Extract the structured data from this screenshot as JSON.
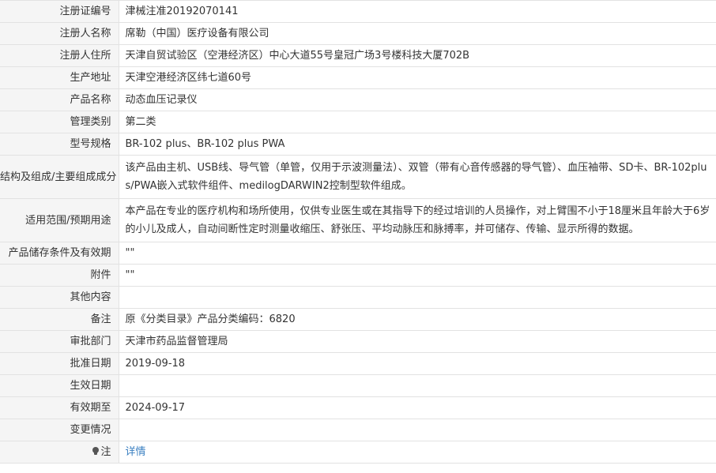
{
  "rows": [
    {
      "label": "注册证编号",
      "value": "津械注准20192070141"
    },
    {
      "label": "注册人名称",
      "value": "席勒（中国）医疗设备有限公司"
    },
    {
      "label": "注册人住所",
      "value": "天津自贸试验区（空港经济区）中心大道55号皇冠广场3号楼科技大厦702B"
    },
    {
      "label": "生产地址",
      "value": "天津空港经济区纬七道60号"
    },
    {
      "label": "产品名称",
      "value": "动态血压记录仪"
    },
    {
      "label": "管理类别",
      "value": "第二类"
    },
    {
      "label": "型号规格",
      "value": "BR-102 plus、BR-102 plus PWA"
    },
    {
      "label": "结构及组成/主要组成成分",
      "value": "该产品由主机、USB线、导气管（单管，仅用于示波测量法）、双管（带有心音传感器的导气管）、血压袖带、SD卡、BR-102plus/PWA嵌入式软件组件、medilogDARWIN2控制型软件组成。"
    },
    {
      "label": "适用范围/预期用途",
      "value": "本产品在专业的医疗机构和场所使用，仅供专业医生或在其指导下的经过培训的人员操作，对上臂围不小于18厘米且年龄大于6岁的小儿及成人，自动间断性定时测量收缩压、舒张压、平均动脉压和脉搏率，并可储存、传输、显示所得的数据。"
    },
    {
      "label": "产品储存条件及有效期",
      "value": "\"\""
    },
    {
      "label": "附件",
      "value": "\"\""
    },
    {
      "label": "其他内容",
      "value": ""
    },
    {
      "label": "备注",
      "value": "原《分类目录》产品分类编码：6820"
    },
    {
      "label": "审批部门",
      "value": "天津市药品监督管理局"
    },
    {
      "label": "批准日期",
      "value": "2019-09-18"
    },
    {
      "label": "生效日期",
      "value": ""
    },
    {
      "label": "有效期至",
      "value": "2024-09-17"
    },
    {
      "label": "变更情况",
      "value": ""
    }
  ],
  "note": {
    "label": "注",
    "icon": "lightbulb-icon",
    "link_text": "详情"
  }
}
